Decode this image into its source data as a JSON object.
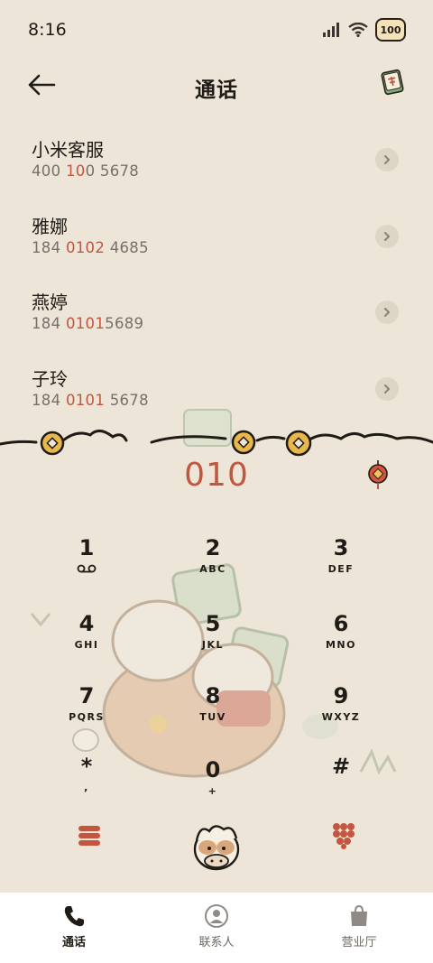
{
  "status": {
    "time": "8:16",
    "battery": "100"
  },
  "header": {
    "title": "通话"
  },
  "recents": [
    {
      "name": "小米客服",
      "num_pre": "400 ",
      "num_hl": "10",
      "num_post": "0 5678"
    },
    {
      "name": "雅娜",
      "num_pre": "184 ",
      "num_hl": "0102",
      "num_post": " 4685"
    },
    {
      "name": "燕婷",
      "num_pre": "184 ",
      "num_hl": "0101",
      "num_post": "5689"
    },
    {
      "name": "子玲",
      "num_pre": "184 ",
      "num_hl": "0101",
      "num_post": " 5678"
    }
  ],
  "dialer": {
    "typed": "010"
  },
  "keys": [
    {
      "digit": "1",
      "letters": ""
    },
    {
      "digit": "2",
      "letters": "ABC"
    },
    {
      "digit": "3",
      "letters": "DEF"
    },
    {
      "digit": "4",
      "letters": "GHI"
    },
    {
      "digit": "5",
      "letters": "JKL"
    },
    {
      "digit": "6",
      "letters": "MNO"
    },
    {
      "digit": "7",
      "letters": "PQRS"
    },
    {
      "digit": "8",
      "letters": "TUV"
    },
    {
      "digit": "9",
      "letters": "WXYZ"
    },
    {
      "digit": "*",
      "letters": ","
    },
    {
      "digit": "0",
      "letters": "+"
    },
    {
      "digit": "#",
      "letters": ""
    }
  ],
  "bottom_nav": [
    {
      "label": "通话",
      "icon": "phone-icon",
      "active": true
    },
    {
      "label": "联系人",
      "icon": "person-icon",
      "active": false
    },
    {
      "label": "营业厅",
      "icon": "shopping-bag-icon",
      "active": false
    }
  ],
  "colors": {
    "background": "#ede6d8",
    "accent": "#c4553e",
    "coin": "#e9b84a",
    "nav_bg": "#ffffff"
  }
}
